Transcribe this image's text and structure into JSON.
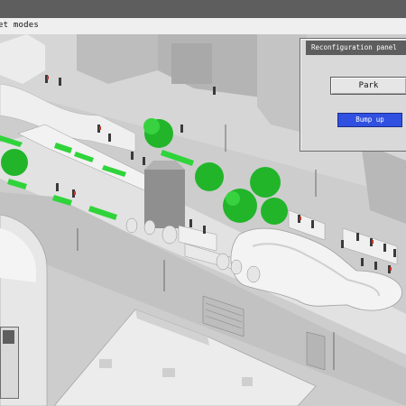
{
  "menubar": {
    "label": "et modes"
  },
  "panel": {
    "title": "Reconfiguration panel",
    "park_label": "Park",
    "bump_label": "Bump up"
  },
  "colors": {
    "titlebar": "#5e5e5e",
    "panel_bg": "#d9d9d9",
    "bump_button": "#2f50e0",
    "grass": "#2fd43a",
    "tree": "#22b52a"
  }
}
